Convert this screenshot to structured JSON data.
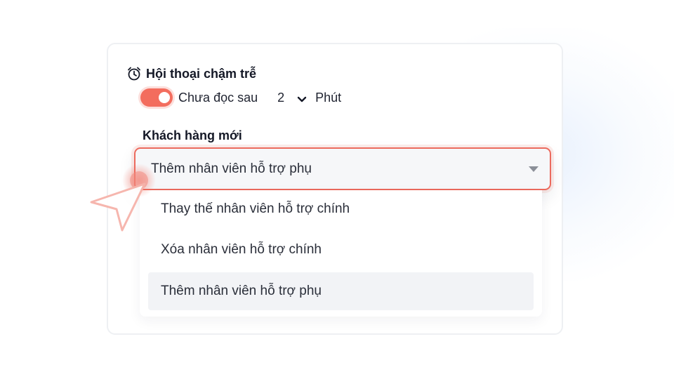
{
  "section": {
    "icon": "alarm-clock-icon",
    "title": "Hội thoại chậm trễ"
  },
  "toggle_row": {
    "toggle_on": true,
    "label": "Chưa đọc sau",
    "minutes_value": "2",
    "unit": "Phút"
  },
  "field": {
    "label": "Khách hàng mới",
    "selected_value": "Thêm nhân viên hỗ trợ phụ"
  },
  "dropdown": {
    "options": [
      "Thay thế nhân viên hỗ trợ chính",
      "Xóa nhân viên hỗ trợ chính",
      "Thêm nhân viên hỗ trợ phụ"
    ],
    "selected_index": 2
  },
  "colors": {
    "accent": "#F36D5E",
    "focus_border": "#EC6A5D",
    "selected_option_bg": "#F2F3F6",
    "text_primary": "#141826"
  }
}
